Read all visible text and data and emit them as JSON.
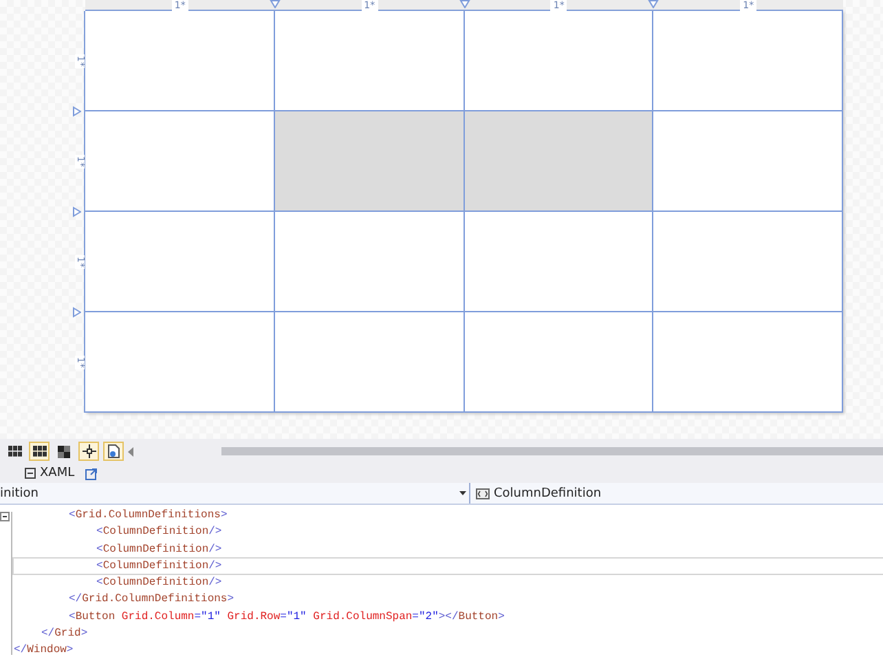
{
  "designer": {
    "columns": [
      {
        "label": "1*"
      },
      {
        "label": "1*"
      },
      {
        "label": "1*"
      },
      {
        "label": "1*"
      }
    ],
    "rows": [
      {
        "label": "1*",
        "cells": [
          {
            "filled": false
          },
          {
            "filled": false
          },
          {
            "filled": false
          },
          {
            "filled": false
          }
        ]
      },
      {
        "label": "1*",
        "cells": [
          {
            "filled": false
          },
          {
            "filled": true
          },
          {
            "filled": true
          },
          {
            "filled": false
          }
        ]
      },
      {
        "label": "1*",
        "cells": [
          {
            "filled": false
          },
          {
            "filled": false
          },
          {
            "filled": false
          },
          {
            "filled": false
          }
        ]
      },
      {
        "label": "1*",
        "cells": [
          {
            "filled": false
          },
          {
            "filled": false
          },
          {
            "filled": false
          },
          {
            "filled": false
          }
        ]
      }
    ]
  },
  "toolbar": {
    "buttons": [
      {
        "kind": "grid",
        "on": false
      },
      {
        "kind": "grid",
        "on": true
      },
      {
        "kind": "checker",
        "on": false
      },
      {
        "kind": "snap",
        "on": true
      },
      {
        "kind": "page",
        "on": true
      }
    ]
  },
  "tabs": [
    {
      "label": "XAML"
    }
  ],
  "breadcrumb": {
    "left": "inition",
    "right": "ColumnDefinition"
  },
  "code": [
    {
      "children": [
        {
          "children": [
            {
              "selected": false,
              "tokens": [
                {
                  "kind": "bracket",
                  "text": "<"
                },
                {
                  "kind": "tag",
                  "text": "Grid.ColumnDefinitions"
                },
                {
                  "kind": "bracket",
                  "text": ">"
                }
              ],
              "children": [
                {
                  "selected": false,
                  "tokens": [
                    {
                      "kind": "bracket",
                      "text": "<"
                    },
                    {
                      "kind": "tag",
                      "text": "ColumnDefinition"
                    },
                    {
                      "kind": "bracket",
                      "text": "/>"
                    }
                  ]
                },
                {
                  "selected": false,
                  "tokens": [
                    {
                      "kind": "bracket",
                      "text": "<"
                    },
                    {
                      "kind": "tag",
                      "text": "ColumnDefinition"
                    },
                    {
                      "kind": "bracket",
                      "text": "/>"
                    }
                  ]
                },
                {
                  "selected": true,
                  "tokens": [
                    {
                      "kind": "bracket",
                      "text": "<"
                    },
                    {
                      "kind": "tag",
                      "text": "ColumnDefinition"
                    },
                    {
                      "kind": "bracket",
                      "text": "/>"
                    }
                  ]
                },
                {
                  "selected": false,
                  "tokens": [
                    {
                      "kind": "bracket",
                      "text": "<"
                    },
                    {
                      "kind": "tag",
                      "text": "ColumnDefinition"
                    },
                    {
                      "kind": "bracket",
                      "text": "/>"
                    }
                  ]
                }
              ]
            },
            {
              "selected": false,
              "tokens": [
                {
                  "kind": "bracket",
                  "text": "</"
                },
                {
                  "kind": "tag",
                  "text": "Grid.ColumnDefinitions"
                },
                {
                  "kind": "bracket",
                  "text": ">"
                }
              ]
            },
            {
              "selected": false,
              "tokens": [
                {
                  "kind": "bracket",
                  "text": "<"
                },
                {
                  "kind": "tag",
                  "text": "Button"
                },
                {
                  "kind": "attr",
                  "text": " Grid.Column"
                },
                {
                  "kind": "value",
                  "text": "=\"1\""
                },
                {
                  "kind": "attr",
                  "text": " Grid.Row"
                },
                {
                  "kind": "value",
                  "text": "=\"1\""
                },
                {
                  "kind": "attr",
                  "text": " Grid.ColumnSpan"
                },
                {
                  "kind": "value",
                  "text": "=\"2\""
                },
                {
                  "kind": "bracket",
                  "text": "></"
                },
                {
                  "kind": "tag",
                  "text": "Button"
                },
                {
                  "kind": "bracket",
                  "text": ">"
                }
              ]
            }
          ]
        },
        {
          "selected": false,
          "tokens": [
            {
              "kind": "bracket",
              "text": "</"
            },
            {
              "kind": "tag",
              "text": "Grid"
            },
            {
              "kind": "bracket",
              "text": ">"
            }
          ]
        }
      ]
    },
    {
      "selected": false,
      "tokens": [
        {
          "kind": "bracket",
          "text": "</"
        },
        {
          "kind": "tag",
          "text": "Window"
        },
        {
          "kind": "bracket",
          "text": ">"
        }
      ]
    }
  ]
}
